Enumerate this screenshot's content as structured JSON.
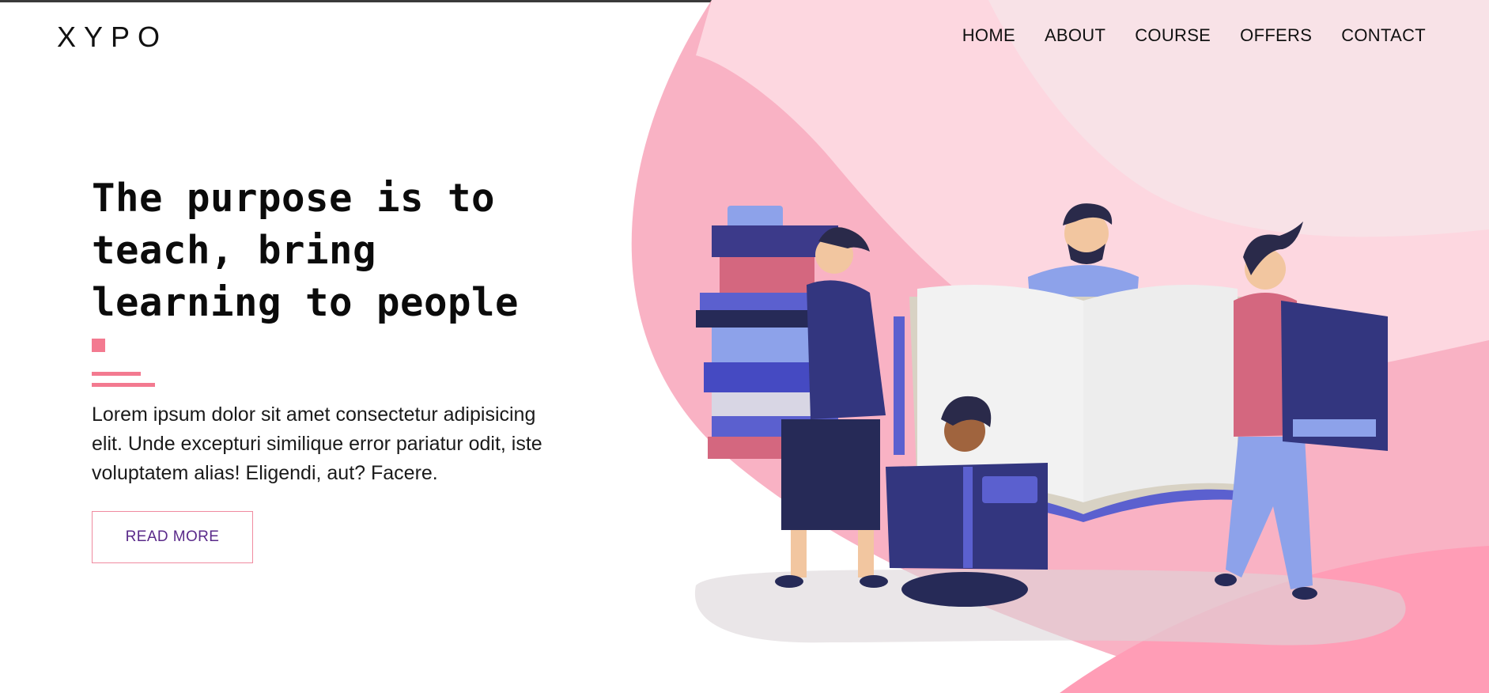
{
  "brand": {
    "logo_text": "XYPO"
  },
  "nav": {
    "items": [
      {
        "label": "HOME"
      },
      {
        "label": "ABOUT"
      },
      {
        "label": "COURSE"
      },
      {
        "label": "OFFERS"
      },
      {
        "label": "CONTACT"
      }
    ]
  },
  "hero": {
    "heading": "The purpose is to teach, bring learning to people",
    "body": "Lorem ipsum dolor sit amet consectetur adipisicing elit. Unde excepturi similique error pariatur odit, iste voluptatem alias! Eligendi, aut? Facere.",
    "cta_label": "READ MORE"
  },
  "colors": {
    "accent_pink": "#f37a90",
    "cta_text": "#5a2a8a",
    "blob_light": "#fdd7e0",
    "blob_mid": "#f9b2c4",
    "blob_dark": "#ff9db6",
    "book_navy": "#33367f",
    "book_blue": "#5b60cf"
  },
  "illustration": {
    "icon": "people-reading-books-illustration"
  }
}
